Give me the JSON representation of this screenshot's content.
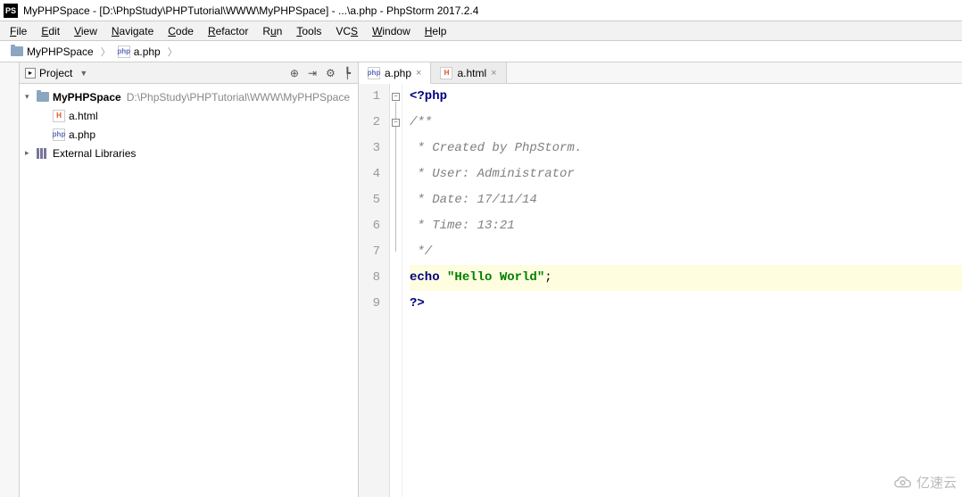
{
  "window": {
    "title": "MyPHPSpace - [D:\\PhpStudy\\PHPTutorial\\WWW\\MyPHPSpace] - ...\\a.php - PhpStorm 2017.2.4"
  },
  "menus": {
    "file": "File",
    "edit": "Edit",
    "view": "View",
    "navigate": "Navigate",
    "code": "Code",
    "refactor": "Refactor",
    "run": "Run",
    "tools": "Tools",
    "vcs": "VCS",
    "window": "Window",
    "help": "Help"
  },
  "breadcrumb": {
    "root": "MyPHPSpace",
    "file": "a.php"
  },
  "project_panel": {
    "label": "Project",
    "root": {
      "name": "MyPHPSpace",
      "path": "D:\\PhpStudy\\PHPTutorial\\WWW\\MyPHPSpace"
    },
    "files": [
      {
        "name": "a.html",
        "type": "html"
      },
      {
        "name": "a.php",
        "type": "php"
      }
    ],
    "libraries": "External Libraries"
  },
  "tabs": {
    "active": "a.php",
    "inactive": "a.html"
  },
  "code": {
    "line1_open": "<?php",
    "line2": "/**",
    "line3": " * Created by PhpStorm.",
    "line4": " * User: Administrator",
    "line5": " * Date: 17/11/14",
    "line6": " * Time: 13:21",
    "line7": " */",
    "line8_kw": "echo ",
    "line8_str": "\"Hello World\"",
    "line8_end": ";",
    "line9": "?>",
    "gutter": [
      "1",
      "2",
      "3",
      "4",
      "5",
      "6",
      "7",
      "8",
      "9"
    ]
  },
  "watermark": "亿速云"
}
